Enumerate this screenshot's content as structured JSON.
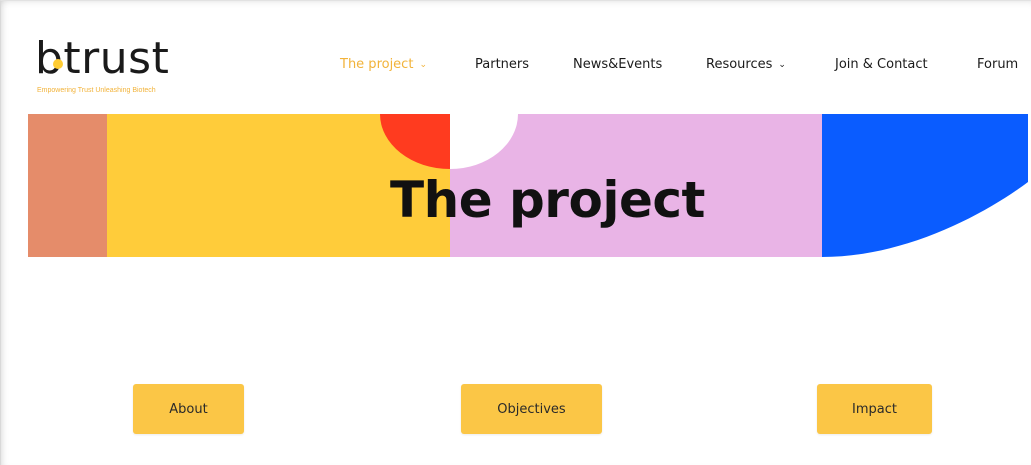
{
  "header": {
    "logo_text": "btrust",
    "tagline": "Empowering Trust Unleashing Biotech"
  },
  "nav": {
    "items": [
      {
        "label": "The project",
        "has_dropdown": true,
        "active": true
      },
      {
        "label": "Partners",
        "has_dropdown": false,
        "active": false
      },
      {
        "label": "News&Events",
        "has_dropdown": false,
        "active": false
      },
      {
        "label": "Resources",
        "has_dropdown": true,
        "active": false
      },
      {
        "label": "Join & Contact",
        "has_dropdown": false,
        "active": false
      },
      {
        "label": "Forum",
        "has_dropdown": false,
        "active": false
      }
    ],
    "dropdown_icon": "chevron-down-icon"
  },
  "banner": {
    "title": "The project",
    "colors": {
      "salmon": "#e58c6a",
      "yellow": "#ffcc3a",
      "red": "#ff3b1f",
      "pink": "#e9b4e6",
      "blue": "#0a5cff"
    }
  },
  "buttons": {
    "about": "About",
    "objectives": "Objectives",
    "impact": "Impact"
  },
  "colors": {
    "accent": "#f2b33a",
    "button_bg": "#fbc646",
    "text": "#1b1b1b"
  }
}
